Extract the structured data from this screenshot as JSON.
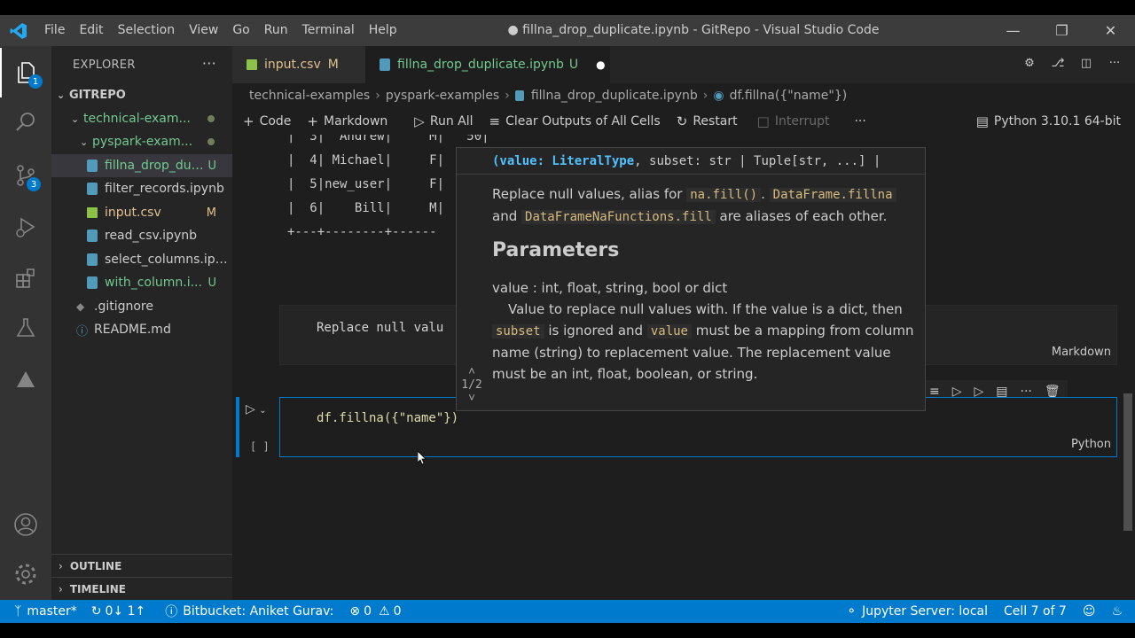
{
  "window": {
    "title": "● fillna_drop_duplicate.ipynb - GitRepo - Visual Studio Code",
    "menu": [
      "File",
      "Edit",
      "Selection",
      "View",
      "Go",
      "Run",
      "Terminal",
      "Help"
    ]
  },
  "activity": {
    "explorer_badge": "1",
    "scm_badge": "3"
  },
  "sidebar": {
    "header": "EXPLORER",
    "root": "GITREPO",
    "tree": [
      {
        "label": "technical-exam...",
        "kind": "folder"
      },
      {
        "label": "pyspark-exam...",
        "kind": "folder"
      },
      {
        "label": "fillna_drop_dupli...",
        "kind": "notebook",
        "deco": "U"
      },
      {
        "label": "filter_records.ipynb",
        "kind": "notebook",
        "deco": ""
      },
      {
        "label": "input.csv",
        "kind": "csv",
        "deco": "M"
      },
      {
        "label": "read_csv.ipynb",
        "kind": "notebook",
        "deco": ""
      },
      {
        "label": "select_columns.ipy...",
        "kind": "notebook",
        "deco": ""
      },
      {
        "label": "with_column.i...",
        "kind": "notebook",
        "deco": "U"
      },
      {
        "label": ".gitignore",
        "kind": "git",
        "deco": ""
      },
      {
        "label": "README.md",
        "kind": "info",
        "deco": ""
      }
    ],
    "outline": "OUTLINE",
    "timeline": "TIMELINE"
  },
  "tabs": [
    {
      "label": "input.csv",
      "deco": "M"
    },
    {
      "label": "fillna_drop_duplicate.ipynb",
      "deco": "U"
    }
  ],
  "breadcrumb": [
    "technical-examples",
    "pyspark-examples",
    "fillna_drop_duplicate.ipynb",
    "df.fillna({\"name\"})"
  ],
  "toolbar": {
    "code": "Code",
    "markdown": "Markdown",
    "run_all": "Run All",
    "clear_outputs": "Clear Outputs of All Cells",
    "restart": "Restart",
    "interrupt": "Interrupt",
    "kernel": "Python 3.10.1 64-bit"
  },
  "output_lines": [
    "|  3|  Andrew|     M|   50|",
    "|  4| Michael|     F|",
    "|  5|new_user|     F|",
    "|  6|    Bill|     M|",
    "+---+--------+------"
  ],
  "markdown_cell": {
    "text": "Replace null valu",
    "kind": "Markdown"
  },
  "code_cell": {
    "code": "df.fillna({\"name\"})",
    "exec": "[ ]",
    "kind": "Python"
  },
  "hover": {
    "signature_param": "(value: LiteralType",
    "signature_rest": ", subset: str | Tuple[str, ...] |",
    "nav": "1/2",
    "desc_1": "Replace null values, alias for",
    "code_1": "na.fill()",
    "desc_1b": ".",
    "code_2": "DataFrame.fillna",
    "desc_2": "and",
    "code_3": "DataFrameNaFunctions.fill",
    "desc_3": "are aliases of each other.",
    "params_heading": "Parameters",
    "param_line": "value : int, float, string, bool or dict",
    "param_desc_1": "Value to replace null values with. If the value is a dict, then",
    "code_4": "subset",
    "param_desc_2": "is ignored and",
    "code_5": "value",
    "param_desc_3": "must be a mapping from column name (string) to replacement value. The replacement value must be an int, float, boolean, or string."
  },
  "status": {
    "branch": "master*",
    "sync": "0↓ 1↑",
    "bitbucket": "Bitbucket: Aniket Gurav:",
    "errors": "0",
    "warnings": "0",
    "jupyter": "Jupyter Server: local",
    "cell": "Cell 7 of 7"
  }
}
